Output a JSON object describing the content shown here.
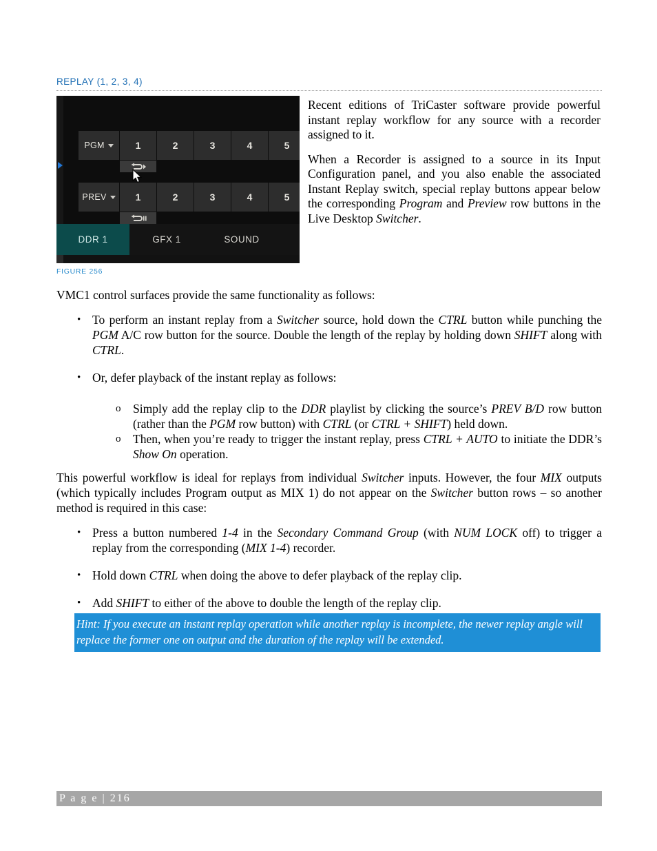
{
  "heading": {
    "title": "REPLAY (1, 2, 3, 4)"
  },
  "figure": {
    "caption": "FIGURE 256",
    "rows": [
      {
        "name": "pgm-row",
        "label": "PGM",
        "buttons": [
          "1",
          "2",
          "3",
          "4",
          "5"
        ],
        "replay_icon": "loop-play-icon"
      },
      {
        "name": "prev-row",
        "label": "PREV",
        "buttons": [
          "1",
          "2",
          "3",
          "4",
          "5"
        ],
        "replay_icon": "loop-pause-icon"
      }
    ],
    "tabs": [
      {
        "label": "DDR 1",
        "active": true
      },
      {
        "label": "GFX 1",
        "active": false
      },
      {
        "label": "SOUND",
        "active": false
      }
    ],
    "colors": {
      "tab_active_bg": "#0c4b4b",
      "panel_bg": "#0d0d0d",
      "button_bg": "#2d2d2d",
      "marker": "#2277d6"
    }
  },
  "side_text": {
    "p1": "Recent editions of TriCaster software provide powerful instant replay workflow for any source with a recorder assigned to it."
  },
  "paragraphs": {
    "vmc1": "VMC1 control surfaces provide the same functionality as follows:"
  },
  "list1": {
    "bullet": "•",
    "item1_bullet": "•",
    "item2_bullet": "•"
  },
  "sublist": {
    "marker": "o"
  },
  "list2": {
    "bullet": "•"
  },
  "hint": {
    "text": "Hint: If you execute an instant replay operation while another replay is incomplete, the newer replay angle will replace the former one on output and the duration of the replay will be extended.",
    "bg_color": "#1f8fd6"
  },
  "footer": {
    "text": "P a g e  |  216",
    "bg_color": "#a6a6a6"
  }
}
